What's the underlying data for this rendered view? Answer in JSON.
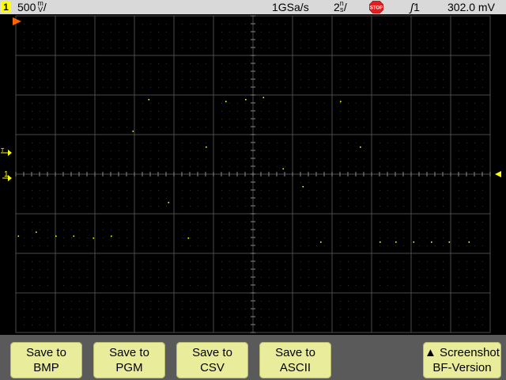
{
  "status": {
    "channel": "1",
    "volts_value": "500",
    "volts_unit_top": "m",
    "volts_unit_bottom": "V",
    "volts_suffix": "/",
    "sample_rate": "1GSa/s",
    "time_value": "2",
    "time_unit_top": "n",
    "time_unit_bottom": "s",
    "time_suffix": "/",
    "run_state": "STOP",
    "trigger_edge_glyph": "ʃ",
    "trigger_source": "1",
    "trigger_level": "302.0 mV"
  },
  "markers": {
    "ground_label": "1",
    "trigger_label": "T"
  },
  "colors": {
    "trace": "#ffff00",
    "grid": "#4a4a4a",
    "status_bg": "#d9d9d9",
    "softkey_bg": "#e9ec9a",
    "softkey_bar": "#5a5a5a",
    "trigger_marker": "#ff6600",
    "stop": "#e02020"
  },
  "softkeys": [
    {
      "line1": "Save to",
      "line2": "BMP"
    },
    {
      "line1": "Save to",
      "line2": "PGM"
    },
    {
      "line1": "Save to",
      "line2": "CSV"
    },
    {
      "line1": "Save to",
      "line2": "ASCII"
    },
    {
      "line1": "▲ Screenshot",
      "line2": "BF-Version"
    }
  ],
  "waveform": {
    "x_unit": "div",
    "y_unit": "div",
    "points": [
      [
        0.05,
        -1.55
      ],
      [
        0.5,
        -1.45
      ],
      [
        1.0,
        -1.55
      ],
      [
        1.45,
        -1.55
      ],
      [
        1.95,
        -1.6
      ],
      [
        2.4,
        -1.55
      ],
      [
        2.95,
        1.1
      ],
      [
        3.35,
        1.9
      ],
      [
        3.85,
        -0.7
      ],
      [
        4.35,
        -1.6
      ],
      [
        4.8,
        0.7
      ],
      [
        5.3,
        1.85
      ],
      [
        5.8,
        1.9
      ],
      [
        6.25,
        1.95
      ],
      [
        6.75,
        0.15
      ],
      [
        7.25,
        -0.3
      ],
      [
        7.7,
        -1.7
      ],
      [
        8.2,
        1.85
      ],
      [
        8.7,
        0.7
      ],
      [
        9.2,
        -1.7
      ],
      [
        9.6,
        -1.7
      ],
      [
        10.05,
        -1.7
      ],
      [
        10.5,
        -1.7
      ],
      [
        10.95,
        -1.7
      ],
      [
        11.45,
        -1.7
      ]
    ]
  }
}
